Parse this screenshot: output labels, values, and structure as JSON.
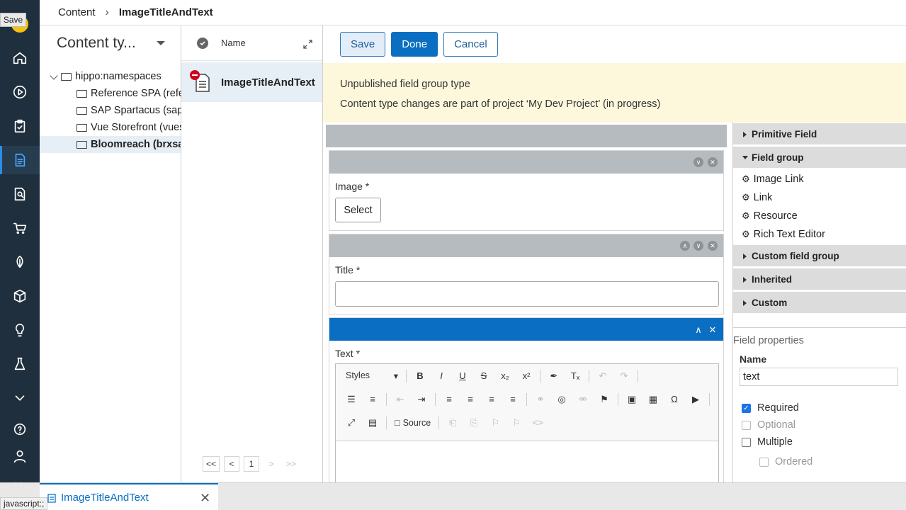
{
  "tooltip": "Save",
  "breadcrumb": {
    "root": "Content",
    "current": "ImageTitleAndText"
  },
  "tree": {
    "title": "Content ty...",
    "nodes": [
      {
        "label": "hippo:namespaces"
      },
      {
        "label": "Reference SPA (refer"
      },
      {
        "label": "SAP Spartacus (saps"
      },
      {
        "label": "Vue Storefront (vues"
      },
      {
        "label": "Bloomreach (brxsaa"
      }
    ]
  },
  "list": {
    "column_name": "Name",
    "row_label": "ImageTitleAndText",
    "pager": [
      "<<",
      "<",
      "1",
      ">",
      ">>"
    ]
  },
  "toolbar": {
    "save": "Save",
    "done": "Done",
    "cancel": "Cancel"
  },
  "notice": {
    "line1": "Unpublished field group type",
    "line2": "Content type changes are part of project ‘My Dev Project’ (in progress)"
  },
  "fields": {
    "image_label": "Image *",
    "select_label": "Select",
    "title_label": "Title *",
    "text_label": "Text *"
  },
  "rte": {
    "styles": "Styles",
    "source": "Source"
  },
  "palette": {
    "primitive": "Primitive Field",
    "field_group": "Field group",
    "items": [
      "Image Link",
      "Link",
      "Resource",
      "Rich Text Editor"
    ],
    "custom_group": "Custom field group",
    "inherited": "Inherited",
    "custom": "Custom"
  },
  "properties": {
    "title": "Field properties",
    "name_label": "Name",
    "name_value": "text",
    "required": "Required",
    "optional": "Optional",
    "multiple": "Multiple",
    "ordered": "Ordered"
  },
  "bottom_tab": "ImageTitleAndText",
  "status_url": "javascript:;"
}
